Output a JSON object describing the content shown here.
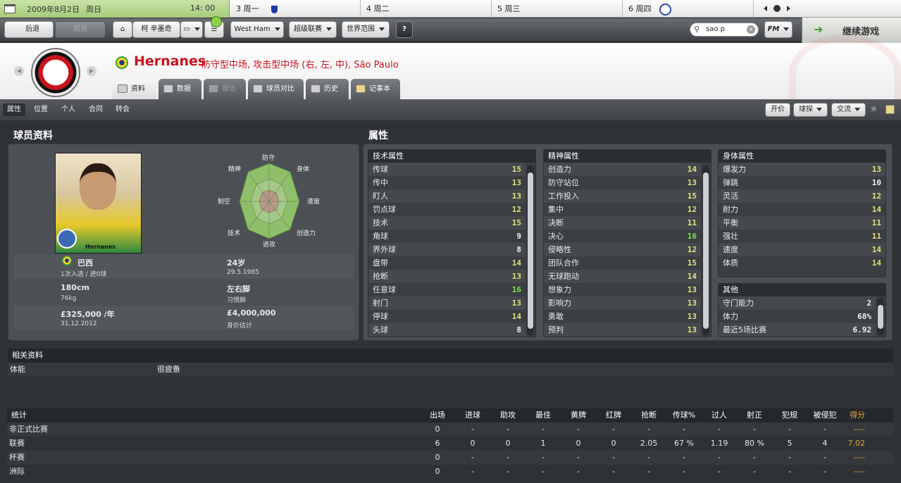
{
  "calendar": {
    "date": "2009年8月2日",
    "weekday": "周日",
    "time": "14: 00",
    "days": [
      {
        "label": "3 周一",
        "icon": "shield-icon"
      },
      {
        "label": "4 周二",
        "icon": ""
      },
      {
        "label": "5 周三",
        "icon": ""
      },
      {
        "label": "6 周四",
        "icon": "club-badge-icon"
      }
    ]
  },
  "toolbar": {
    "back": "后退",
    "forward": "前进",
    "manager": "柯 辛墨奇",
    "club": "West Ham",
    "league": "超级联赛",
    "world": "世界范围",
    "help": "?",
    "search_value": "sao p",
    "fm_label": "FM",
    "continue": "继续游戏"
  },
  "player": {
    "name": "Hernanes",
    "positions": "防守型中场, 攻击型中场 (右, 左, 中), São Paulo",
    "card_name": "Hernanes",
    "nationality": "巴西",
    "caps": "1次入选 / 进0球",
    "age": "24岁",
    "dob": "29.5.1985",
    "height": "180cm",
    "weight": "76kg",
    "foot": "左右脚",
    "foot_label": "习惯脚",
    "wage": "£325,000 /年",
    "contract_end": "31.12.2012",
    "value": "£4,000,000",
    "value_label": "身价估计"
  },
  "tabs": [
    {
      "label": "资料",
      "state": "active"
    },
    {
      "label": "数据",
      "state": "normal"
    },
    {
      "label": "报告",
      "state": "disabled"
    },
    {
      "label": "球员对比",
      "state": "normal"
    },
    {
      "label": "历史",
      "state": "normal"
    },
    {
      "label": "记事本",
      "state": "normal"
    }
  ],
  "subnav": {
    "items": [
      "属性",
      "位置",
      "个人",
      "合同",
      "转会"
    ],
    "offer": "开价",
    "scout": "球探",
    "interact": "交流"
  },
  "sections": {
    "profile": "球员资料",
    "attributes": "属性",
    "related": "相关资料"
  },
  "radar": {
    "labels": [
      "防守",
      "身体",
      "速度",
      "创造力",
      "进攻",
      "技术",
      "制空",
      "精神"
    ]
  },
  "technical": {
    "title": "技术属性",
    "rows": [
      {
        "name": "传球",
        "value": "15"
      },
      {
        "name": "传中",
        "value": "13"
      },
      {
        "name": "盯人",
        "value": "13"
      },
      {
        "name": "罚点球",
        "value": "12"
      },
      {
        "name": "技术",
        "value": "15"
      },
      {
        "name": "角球",
        "value": "9"
      },
      {
        "name": "界外球",
        "value": "8"
      },
      {
        "name": "盘带",
        "value": "14"
      },
      {
        "name": "抢断",
        "value": "13"
      },
      {
        "name": "任意球",
        "value": "16"
      },
      {
        "name": "射门",
        "value": "13"
      },
      {
        "name": "停球",
        "value": "14"
      },
      {
        "name": "头球",
        "value": "8"
      }
    ]
  },
  "mental": {
    "title": "精神属性",
    "rows": [
      {
        "name": "创造力",
        "value": "14"
      },
      {
        "name": "防守站位",
        "value": "13"
      },
      {
        "name": "工作投入",
        "value": "15"
      },
      {
        "name": "集中",
        "value": "12"
      },
      {
        "name": "决断",
        "value": "11"
      },
      {
        "name": "决心",
        "value": "16"
      },
      {
        "name": "侵略性",
        "value": "12"
      },
      {
        "name": "团队合作",
        "value": "15"
      },
      {
        "name": "无球跑动",
        "value": "14"
      },
      {
        "name": "想象力",
        "value": "13"
      },
      {
        "name": "影响力",
        "value": "13"
      },
      {
        "name": "勇敢",
        "value": "13"
      },
      {
        "name": "预判",
        "value": "13"
      }
    ]
  },
  "physical": {
    "title": "身体属性",
    "rows": [
      {
        "name": "爆发力",
        "value": "13"
      },
      {
        "name": "弹跳",
        "value": "10"
      },
      {
        "name": "灵活",
        "value": "12"
      },
      {
        "name": "耐力",
        "value": "14"
      },
      {
        "name": "平衡",
        "value": "11"
      },
      {
        "name": "强壮",
        "value": "11"
      },
      {
        "name": "速度",
        "value": "14"
      },
      {
        "name": "体质",
        "value": "14"
      }
    ]
  },
  "other": {
    "title": "其他",
    "rows": [
      {
        "name": "守门能力",
        "value": "2"
      },
      {
        "name": "体力",
        "value": "68%"
      },
      {
        "name": "最近5场比赛",
        "value": "6.92"
      }
    ]
  },
  "related": {
    "label": "体能",
    "value": "很疲惫"
  },
  "stats": {
    "headers": [
      "统计",
      "出场",
      "进球",
      "助攻",
      "最佳",
      "黄牌",
      "红牌",
      "抢断",
      "传球%",
      "过人",
      "射正",
      "犯规",
      "被侵犯",
      "得分"
    ],
    "rows": [
      [
        "非正式比赛",
        "0",
        "-",
        "-",
        "-",
        "-",
        "-",
        "-",
        "-",
        "-",
        "-",
        "-",
        "-",
        "----"
      ],
      [
        "联赛",
        "6",
        "0",
        "0",
        "1",
        "0",
        "0",
        "2.05",
        "67 %",
        "1.19",
        "80 %",
        "5",
        "4",
        "7.02"
      ],
      [
        "杯赛",
        "0",
        "-",
        "-",
        "-",
        "-",
        "-",
        "-",
        "-",
        "-",
        "-",
        "-",
        "-",
        "----"
      ],
      [
        "洲际",
        "0",
        "-",
        "-",
        "-",
        "-",
        "-",
        "-",
        "-",
        "-",
        "-",
        "-",
        "-",
        "----"
      ]
    ]
  },
  "colors": {
    "value_yellow": "#e0e27a",
    "value_green": "#7ee04c",
    "value_white": "#f0f0f0",
    "name_red": "#c8141e",
    "score_orange": "#e6a23c"
  }
}
